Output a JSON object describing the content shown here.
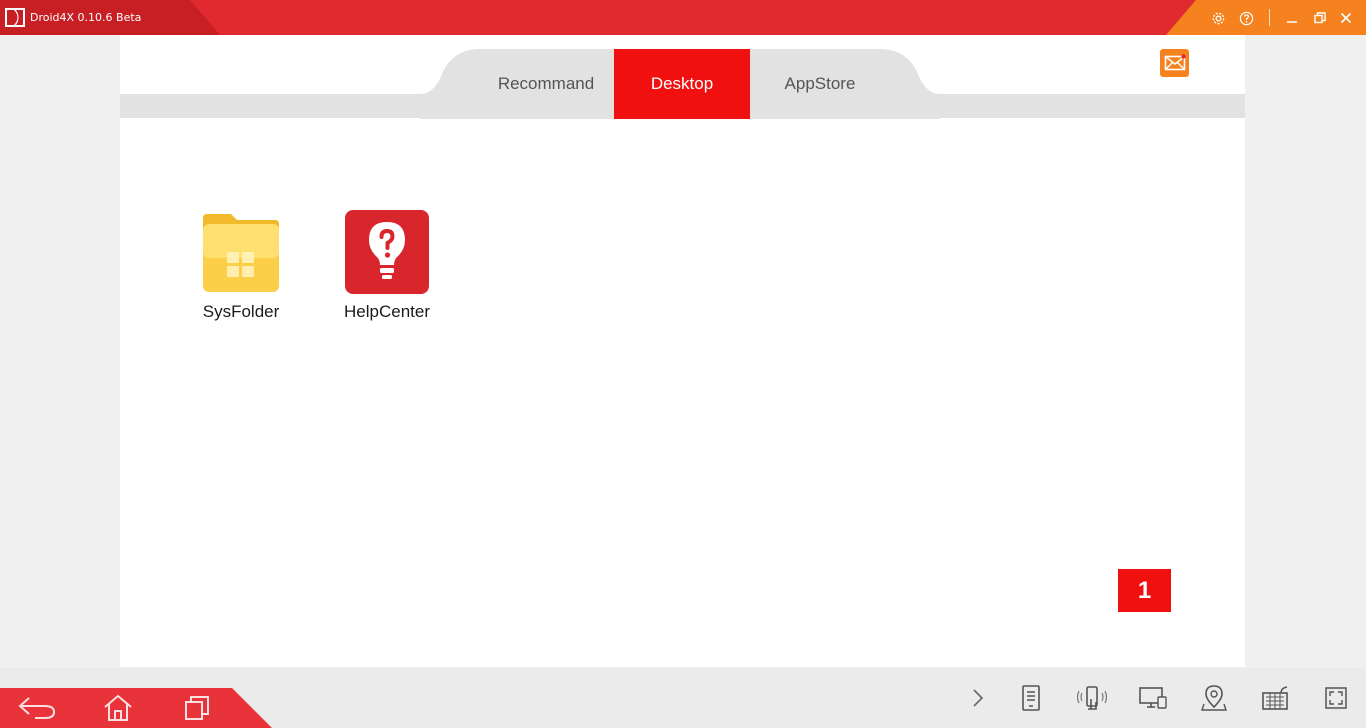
{
  "window": {
    "title": "Droid4X 0.10.6 Beta",
    "icons": [
      "app-logo",
      "settings-icon",
      "help-icon",
      "minimize-icon",
      "restore-icon",
      "close-icon"
    ]
  },
  "tabs": [
    {
      "label": "Recommand",
      "active": false
    },
    {
      "label": "Desktop",
      "active": true
    },
    {
      "label": "AppStore",
      "active": false
    }
  ],
  "desktop": {
    "apps": [
      {
        "label": "SysFolder",
        "icon": "folder-icon"
      },
      {
        "label": "HelpCenter",
        "icon": "help-center-icon"
      }
    ],
    "page_number": "1"
  },
  "navigation": {
    "buttons": [
      "back-icon",
      "home-icon",
      "recent-apps-icon"
    ]
  },
  "toolbar": {
    "buttons": [
      "expand-icon",
      "apk-install-icon",
      "shake-icon",
      "screen-icon",
      "location-icon",
      "keyboard-icon",
      "fullscreen-icon"
    ]
  },
  "colors": {
    "brand_red": "#e02a2f",
    "accent_orange": "#f5821f",
    "active_tab": "#f01010"
  }
}
